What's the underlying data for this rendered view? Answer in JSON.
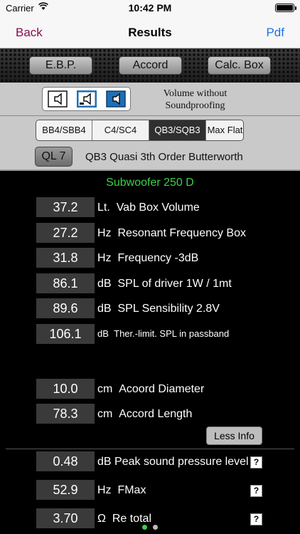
{
  "status_bar": {
    "carrier": "Carrier",
    "time": "10:42 PM",
    "battery_level": 1.0
  },
  "nav": {
    "back_label": "Back",
    "title": "Results",
    "pdf_label": "Pdf"
  },
  "toolbar": {
    "ebp_label": "E.B.P.",
    "accord_label": "Accord",
    "calc_box_label": "Calc. Box"
  },
  "speaker_options": [
    {
      "icon": "speaker-sealed-icon",
      "selected": false
    },
    {
      "icon": "speaker-ported-icon",
      "selected": true
    },
    {
      "icon": "speaker-bandpass-icon",
      "selected": true
    }
  ],
  "volume_note": {
    "line1": "Volume without",
    "line2": "Soundproofing"
  },
  "alignment_tabs": [
    {
      "label": "BB4/SBB4",
      "selected": false
    },
    {
      "label": "C4/SC4",
      "selected": false
    },
    {
      "label": "QB3/SQB3",
      "selected": true
    },
    {
      "label": "Max Flat",
      "selected": false
    }
  ],
  "ql": {
    "button_label": "QL 7",
    "description": "QB3 Quasi 3th Order Butterworth"
  },
  "model_name": "Subwoofer 250 D",
  "results": [
    {
      "value": "37.2",
      "unit": "Lt.",
      "label": "Vab Box Volume"
    },
    {
      "value": "27.2",
      "unit": "Hz",
      "label": "Resonant Frequency Box"
    },
    {
      "value": "31.8",
      "unit": "Hz",
      "label": "Frequency -3dB"
    },
    {
      "value": "86.1",
      "unit": "dB",
      "label": "SPL of driver 1W / 1mt"
    },
    {
      "value": "89.6",
      "unit": "dB",
      "label": "SPL Sensibility 2.8V"
    },
    {
      "value": "106.1",
      "unit": "dB",
      "label": "Ther.-limit. SPL in passband"
    }
  ],
  "accord": [
    {
      "value": "10.0",
      "unit": "cm",
      "label": "Acoord Diameter"
    },
    {
      "value": "78.3",
      "unit": "cm",
      "label": "Accord Length"
    }
  ],
  "less_info_label": "Less Info",
  "extra": [
    {
      "value": "0.48",
      "unit": "dB",
      "label": "Peak sound pressure level",
      "help": "?"
    },
    {
      "value": "52.9",
      "unit": "Hz",
      "label": "FMax",
      "help": "?"
    },
    {
      "value": "3.70",
      "unit": "Ω",
      "label": "Re total",
      "help": "?"
    }
  ],
  "page_indicator": {
    "count": 2,
    "current": 1
  },
  "colors": {
    "back": "#8a0d4d",
    "pdf": "#1a73e8",
    "model": "#3bd14b",
    "speaker_selected": "#1f6fb4",
    "dot_active": "#3bd14b"
  }
}
